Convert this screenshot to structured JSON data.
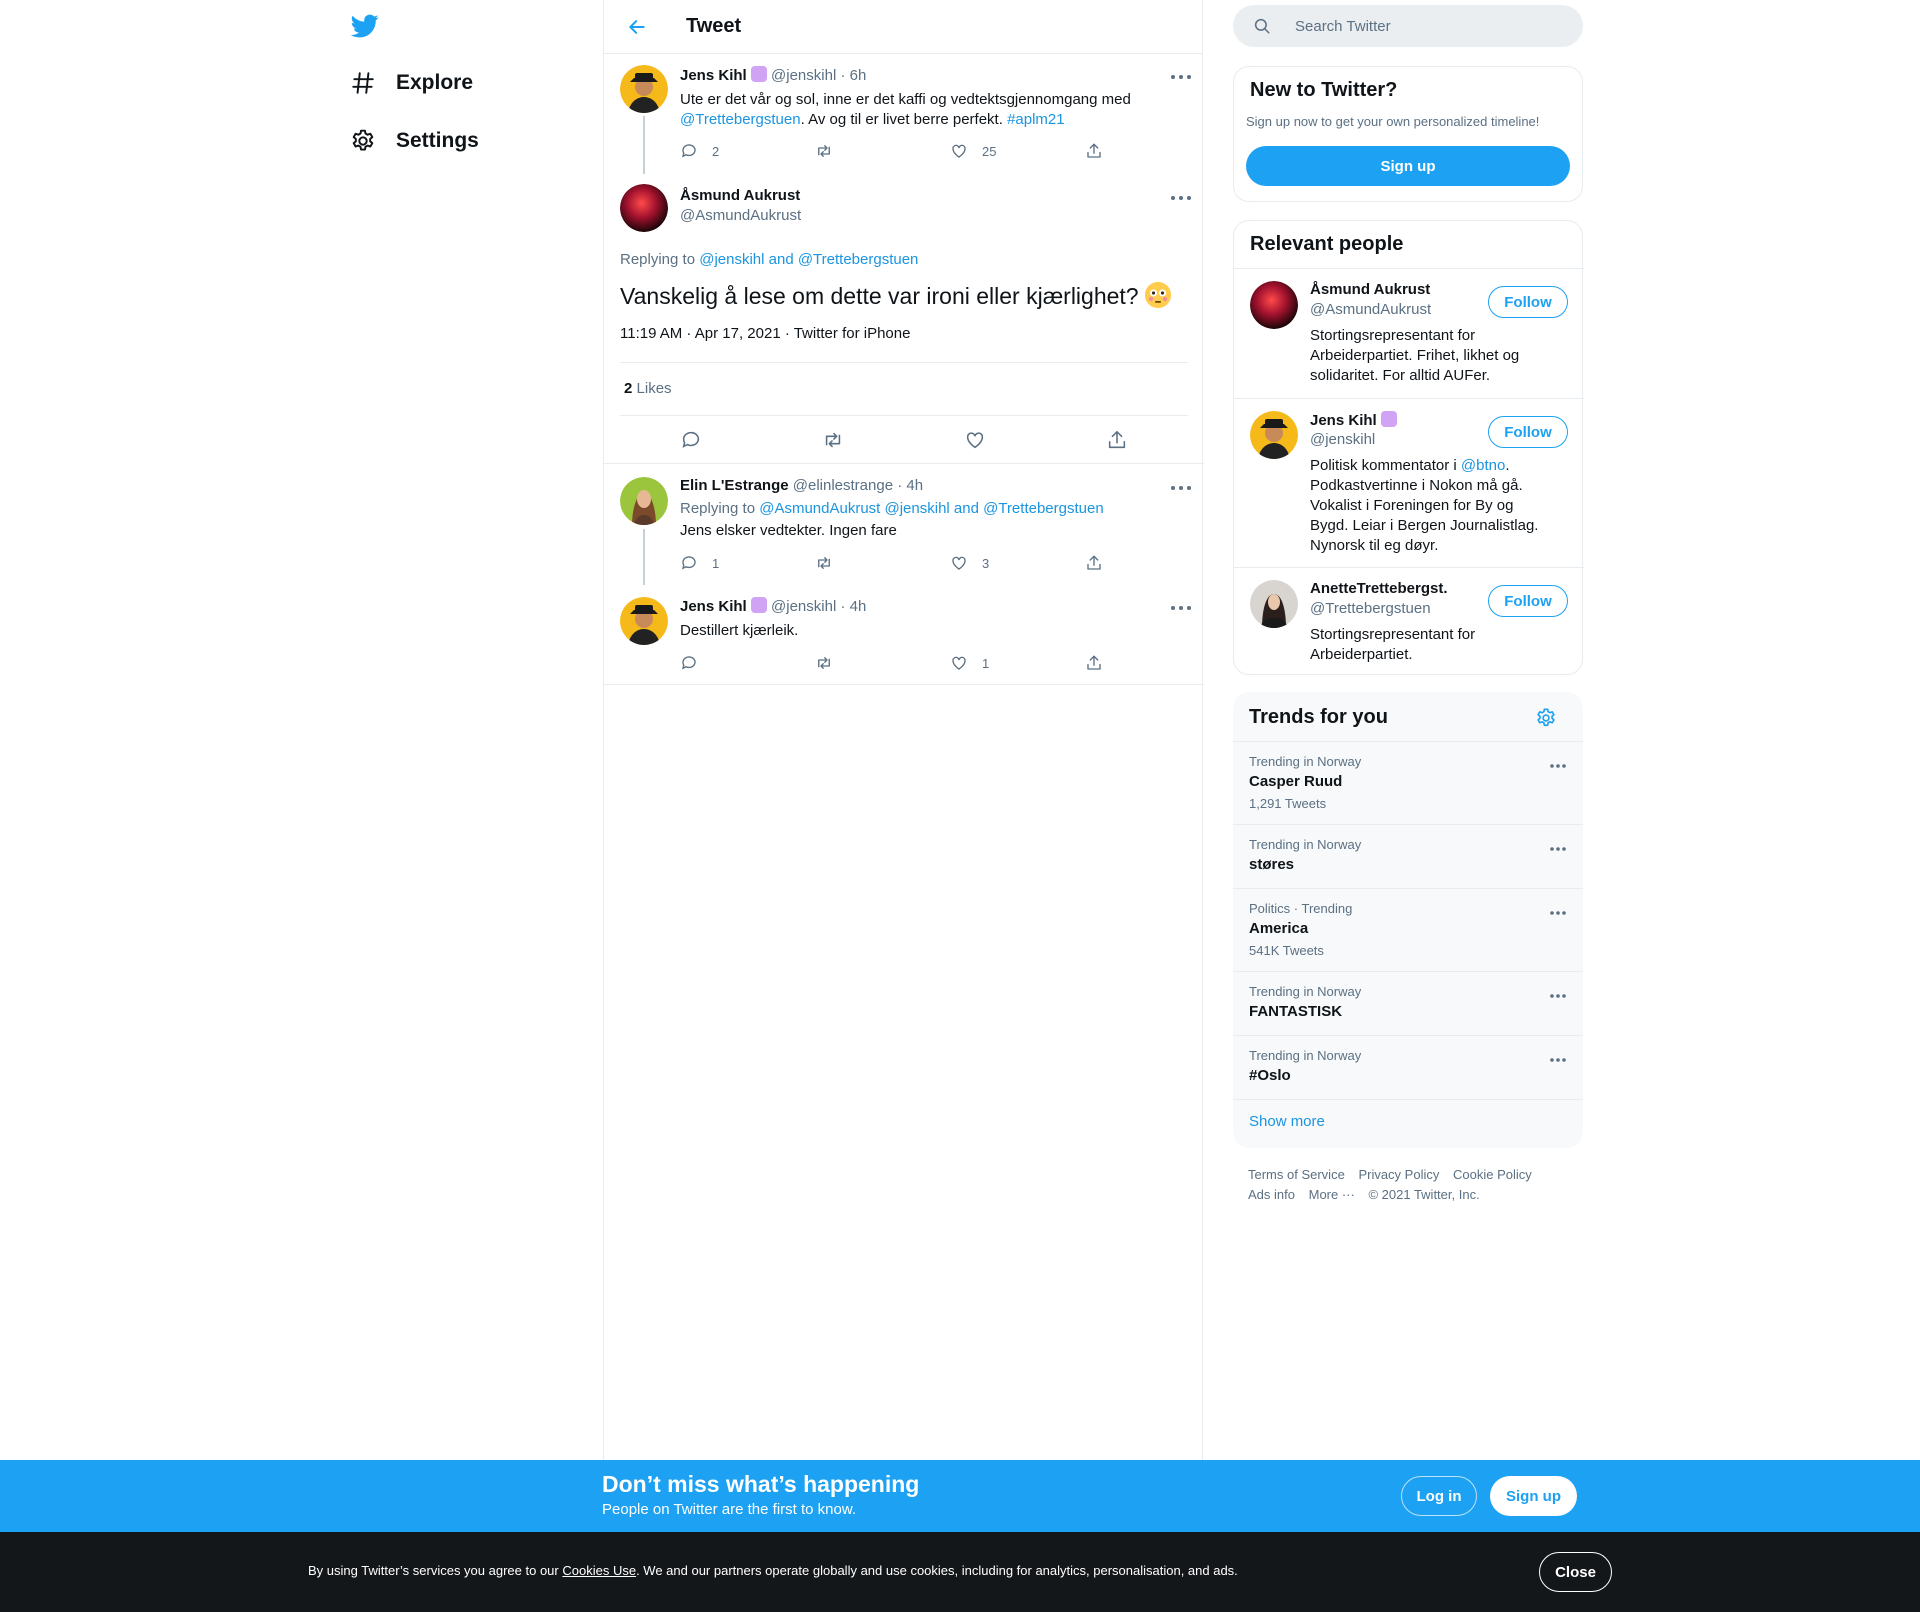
{
  "nav": {
    "logo": "twitter-bird-icon",
    "items": [
      {
        "label": "Explore",
        "icon": "hashtag-icon"
      },
      {
        "label": "Settings",
        "icon": "gear-icon"
      }
    ]
  },
  "header": {
    "title": "Tweet",
    "back_icon": "arrow-left-icon"
  },
  "parent_tweet": {
    "name": "Jens Kihl",
    "handle": "@jenskihl",
    "time": "· 6h",
    "text_before": "Ute er det vår og sol, inne er det kaffi og vedtektsgjennomgang med ",
    "mention": "@Trettebergstuen",
    "text_mid": ". Av og til er livet berre perfekt. ",
    "hashtag": "#aplm21",
    "replies": "2",
    "likes": "25"
  },
  "focused_tweet": {
    "name": "Åsmund Aukrust",
    "handle": "@AsmundAukrust",
    "replying_prefix": "Replying to ",
    "replying_to": "@jenskihl and @Trettebergstuen",
    "text": "Vanskelig å lese om dette var ironi eller kjærlighet?",
    "timestamp": "11:19 AM · Apr 17, 2021 · Twitter for iPhone",
    "likes_count": "2",
    "likes_label": "Likes"
  },
  "replies": [
    {
      "name": "Elin L'Estrange",
      "handle": "@elinlestrange",
      "time": "· 4h",
      "replying_prefix": "Replying to ",
      "replying_to": "@AsmundAukrust @jenskihl and @Trettebergstuen",
      "text": "Jens elsker vedtekter. Ingen fare",
      "replies": "1",
      "likes": "3"
    },
    {
      "name": "Jens Kihl",
      "handle": "@jenskihl",
      "time": "· 4h",
      "text": "Destillert kjærleik.",
      "replies": "",
      "likes": "1"
    }
  ],
  "search": {
    "placeholder": "Search Twitter"
  },
  "new_to_twitter": {
    "title": "New to Twitter?",
    "subtitle": "Sign up now to get your own personalized timeline!",
    "button": "Sign up"
  },
  "relevant_people": {
    "title": "Relevant people",
    "follow_label": "Follow",
    "people": [
      {
        "name": "Åsmund Aukrust",
        "handle": "@AsmundAukrust",
        "bio": "Stortingsrepresentant for Arbeiderpartiet. Frihet, likhet og solidaritet. For alltid AUFer."
      },
      {
        "name": "Jens Kihl",
        "handle": "@jenskihl",
        "bio_prefix": "Politisk kommentator i ",
        "bio_link": "@btno",
        "bio_suffix": ". Podkastvertinne i Nokon må gå. Vokalist i Foreningen for By og Bygd. Leiar i Bergen Journalistlag. Nynorsk til eg døyr."
      },
      {
        "name": "AnetteTrettebergst.",
        "handle": "@Trettebergstuen",
        "bio": "Stortingsrepresentant for Arbeiderpartiet."
      }
    ]
  },
  "trends": {
    "title": "Trends for you",
    "items": [
      {
        "context": "Trending in Norway",
        "name": "Casper Ruud",
        "count": "1,291 Tweets"
      },
      {
        "context": "Trending in Norway",
        "name": "støres",
        "count": ""
      },
      {
        "context": "Politics · Trending",
        "name": "America",
        "count": "541K Tweets"
      },
      {
        "context": "Trending in Norway",
        "name": "FANTASTISK",
        "count": ""
      },
      {
        "context": "Trending in Norway",
        "name": "#Oslo",
        "count": ""
      }
    ],
    "show_more": "Show more"
  },
  "footer": {
    "terms": "Terms of Service",
    "privacy": "Privacy Policy",
    "cookie": "Cookie Policy",
    "ads": "Ads info",
    "more": "More ···",
    "copyright": "© 2021 Twitter, Inc."
  },
  "bottom_bar": {
    "title": "Don’t miss what’s happening",
    "subtitle": "People on Twitter are the first to know.",
    "login": "Log in",
    "signup": "Sign up"
  },
  "cookie_bar": {
    "text_before": "By using Twitter’s services you agree to our ",
    "link": "Cookies Use",
    "text_after": ". We and our partners operate globally and use cookies, including for analytics, personalisation, and ads.",
    "close": "Close"
  },
  "colors": {
    "accent": "#1da1f2",
    "link": "#1b95e0",
    "muted": "#5b7083",
    "cookie_bg": "#14171a"
  }
}
